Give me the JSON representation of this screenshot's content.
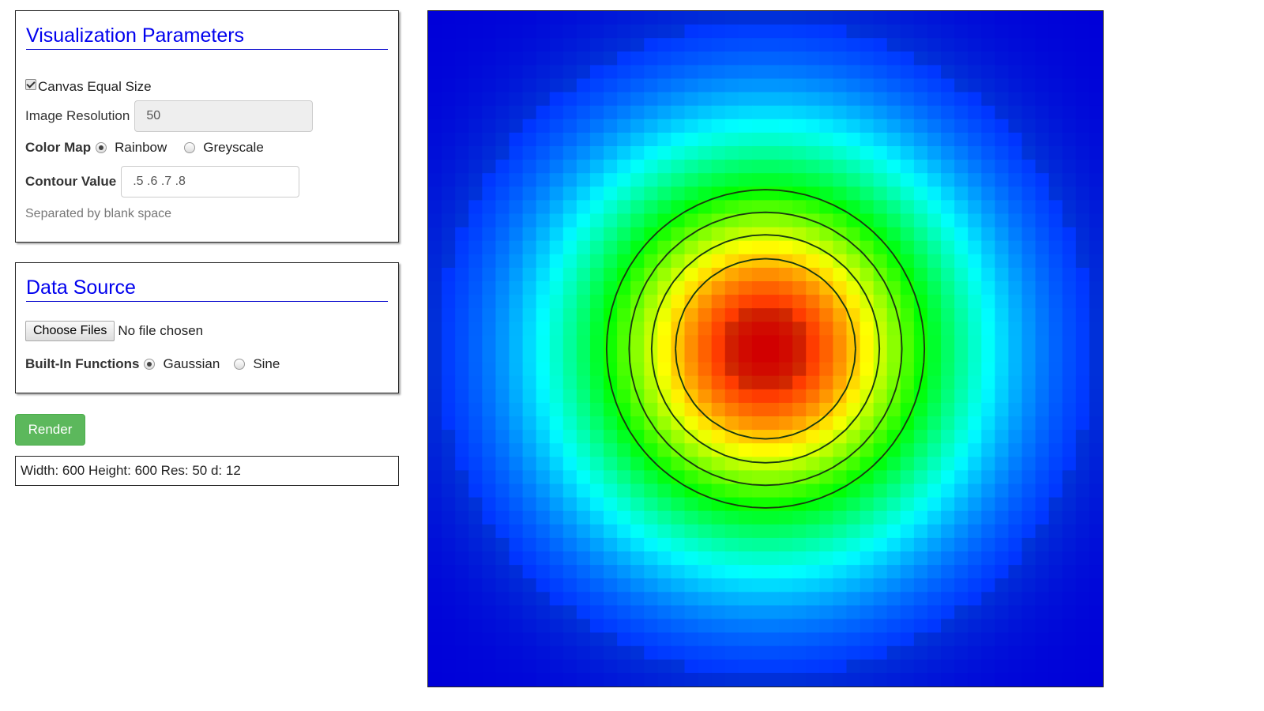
{
  "params": {
    "title": "Visualization Parameters",
    "canvas_equal_size_label": "Canvas Equal Size",
    "canvas_equal_size_checked": true,
    "image_resolution_label": "Image Resolution",
    "image_resolution_value": "50",
    "color_map_label": "Color Map",
    "color_map_options": [
      "Rainbow",
      "Greyscale"
    ],
    "color_map_selected": "Rainbow",
    "contour_value_label": "Contour Value",
    "contour_value": ".5 .6 .7 .8",
    "contour_hint": "Separated by blank space"
  },
  "source": {
    "title": "Data Source",
    "choose_files_label": "Choose Files",
    "no_file_text": "No file chosen",
    "builtin_label": "Built-In Functions",
    "builtin_options": [
      "Gaussian",
      "Sine"
    ],
    "builtin_selected": "Gaussian"
  },
  "render_label": "Render",
  "status_text": "Width: 600 Height: 600 Res: 50 d: 12",
  "visualization": {
    "resolution": 50,
    "function": "Gaussian",
    "color_map": "Rainbow",
    "contour_levels": [
      0.5,
      0.6,
      0.7,
      0.8
    ],
    "contour_color": "#1a3a10"
  }
}
